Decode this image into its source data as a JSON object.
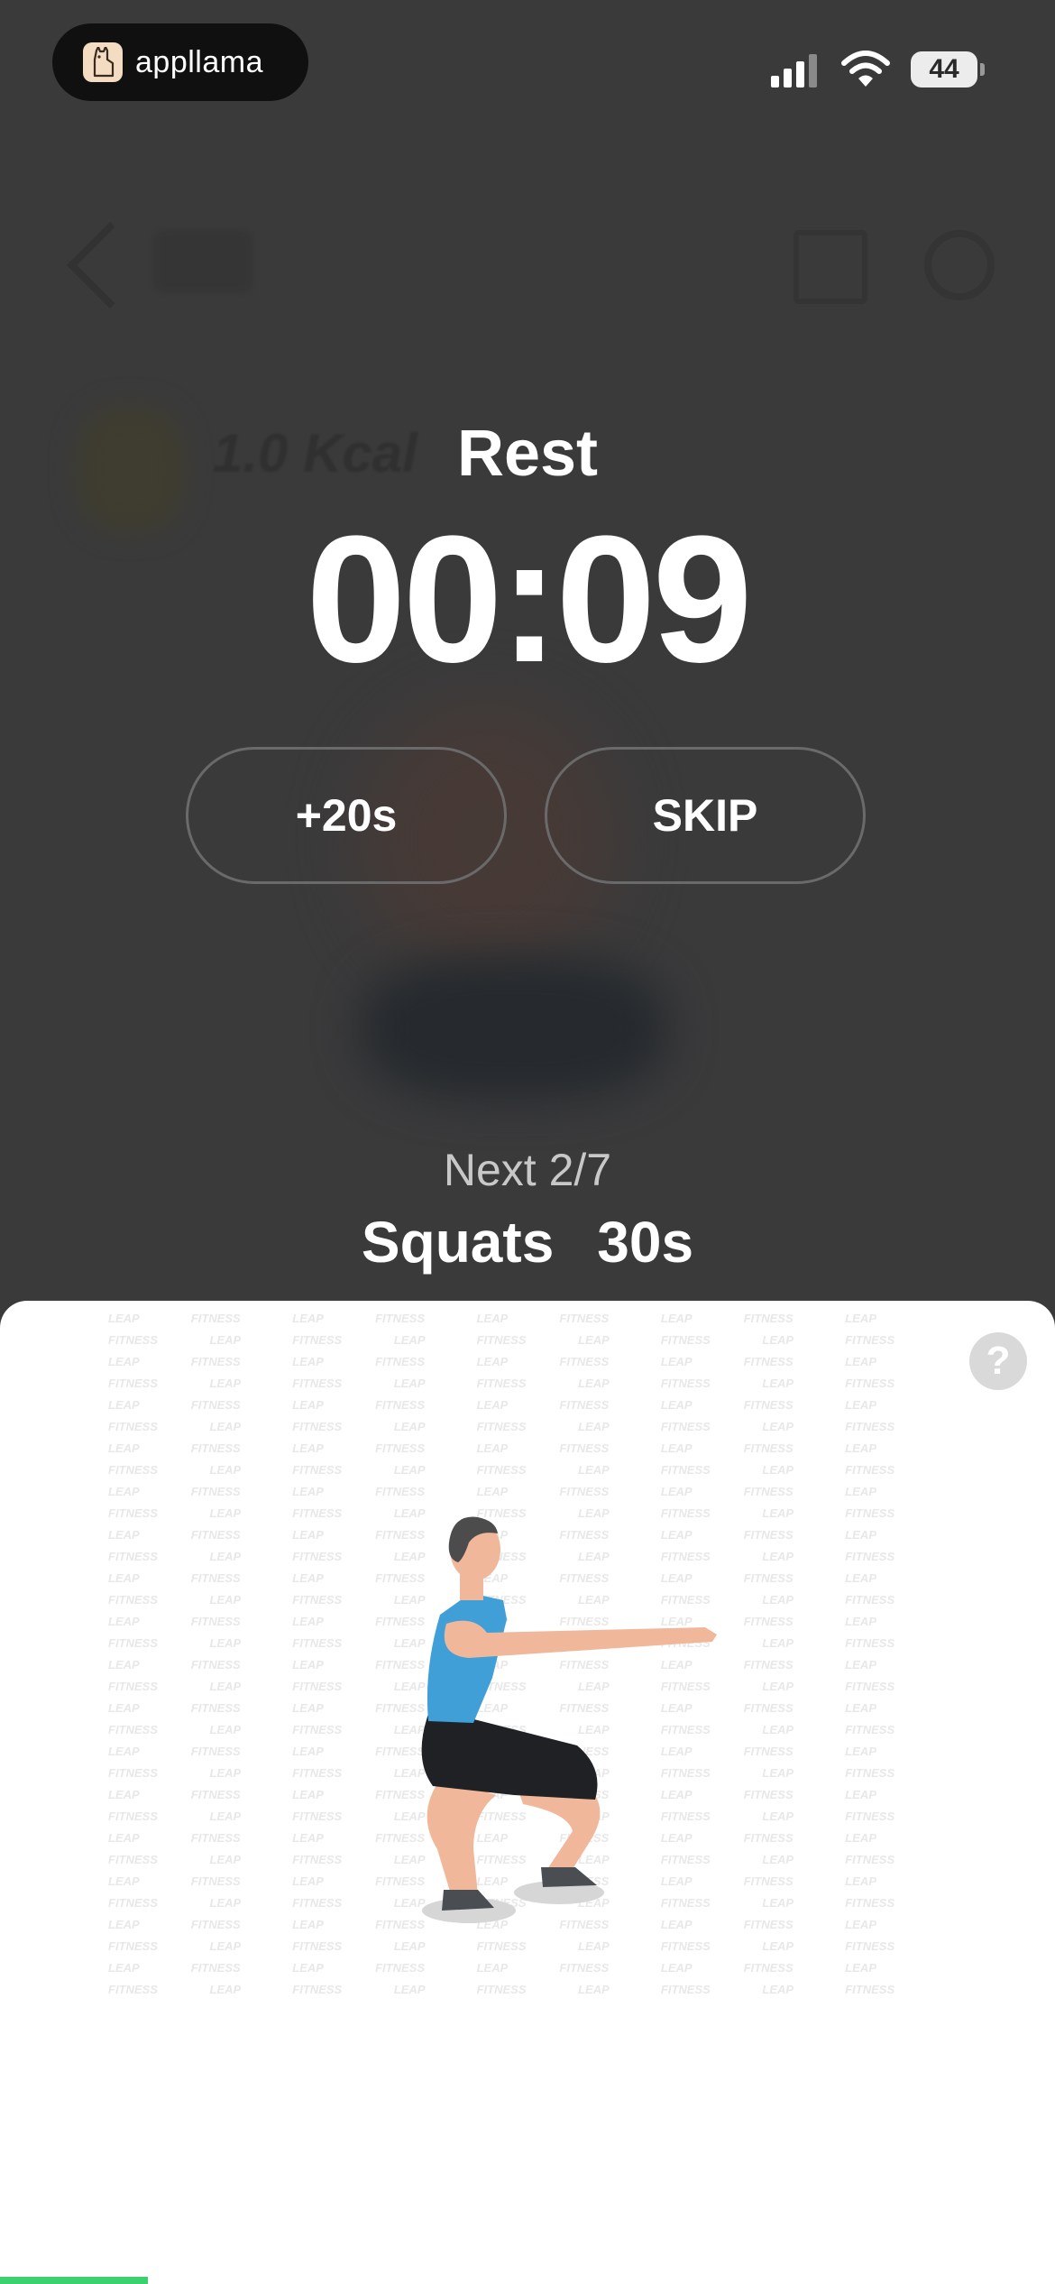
{
  "status_bar": {
    "app_badge_text": "appllama",
    "battery": "44"
  },
  "background": {
    "calories": "1.0 Kcal"
  },
  "rest": {
    "title": "Rest",
    "timer": "00:09",
    "add_time_label": "+20s",
    "skip_label": "SKIP"
  },
  "next": {
    "label": "Next 2/7",
    "exercise_name": "Squats",
    "duration": "30s"
  },
  "panel": {
    "watermark_text": "LEAP FITNESS",
    "help_label": "?"
  },
  "progress": {
    "fraction": 0.14
  },
  "colors": {
    "overlay": "#3a3a3b",
    "progress": "#3bd16f",
    "shirt": "#3f9fd6",
    "skin": "#f0b79a",
    "shorts": "#1f2124"
  },
  "icons": [
    "signal-icon",
    "wifi-icon",
    "battery-icon",
    "help-icon",
    "llama-logo-icon"
  ]
}
